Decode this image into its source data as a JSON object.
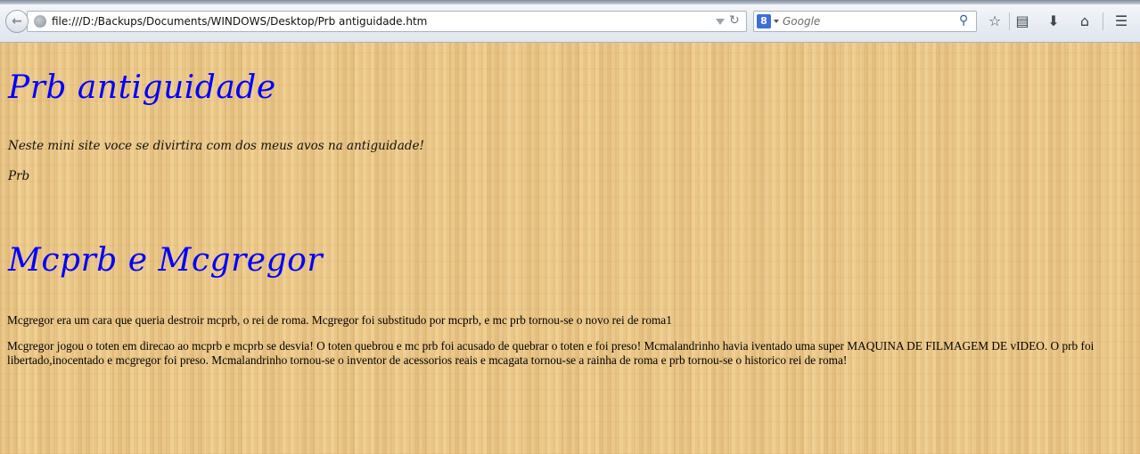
{
  "browser": {
    "url": "file:///D:/Backups/Documents/WINDOWS/Desktop/Prb antiguidade.htm",
    "search_placeholder": "Google",
    "search_engine_letter": "8"
  },
  "page": {
    "heading1": "Prb antiguidade",
    "intro": "Neste mini site voce se divirtira com dos meus avos na antiguidade!",
    "signature": "Prb",
    "heading2": "Mcprb e Mcgregor",
    "paragraph1": "Mcgregor era um cara que queria destroir mcprb, o rei de roma. Mcgregor foi substitudo por mcprb, e mc prb tornou-se o novo rei de roma1",
    "paragraph2": "Mcgregor jogou o toten em direcao ao mcprb e mcprb se desvia! O toten quebrou e mc prb foi acusado de quebrar o toten e foi preso! Mcmalandrinho havia iventado uma super MAQUINA DE FILMAGEM DE vIDEO. O prb foi libertado,inocentado e mcgregor foi preso. Mcmalandrinho tornou-se o inventor de acessorios reais e mcagata tornou-se a rainha de roma e prb tornou-se o historico rei de roma!"
  },
  "colors": {
    "heading": "#0000ff",
    "background": "#ecc98a"
  }
}
